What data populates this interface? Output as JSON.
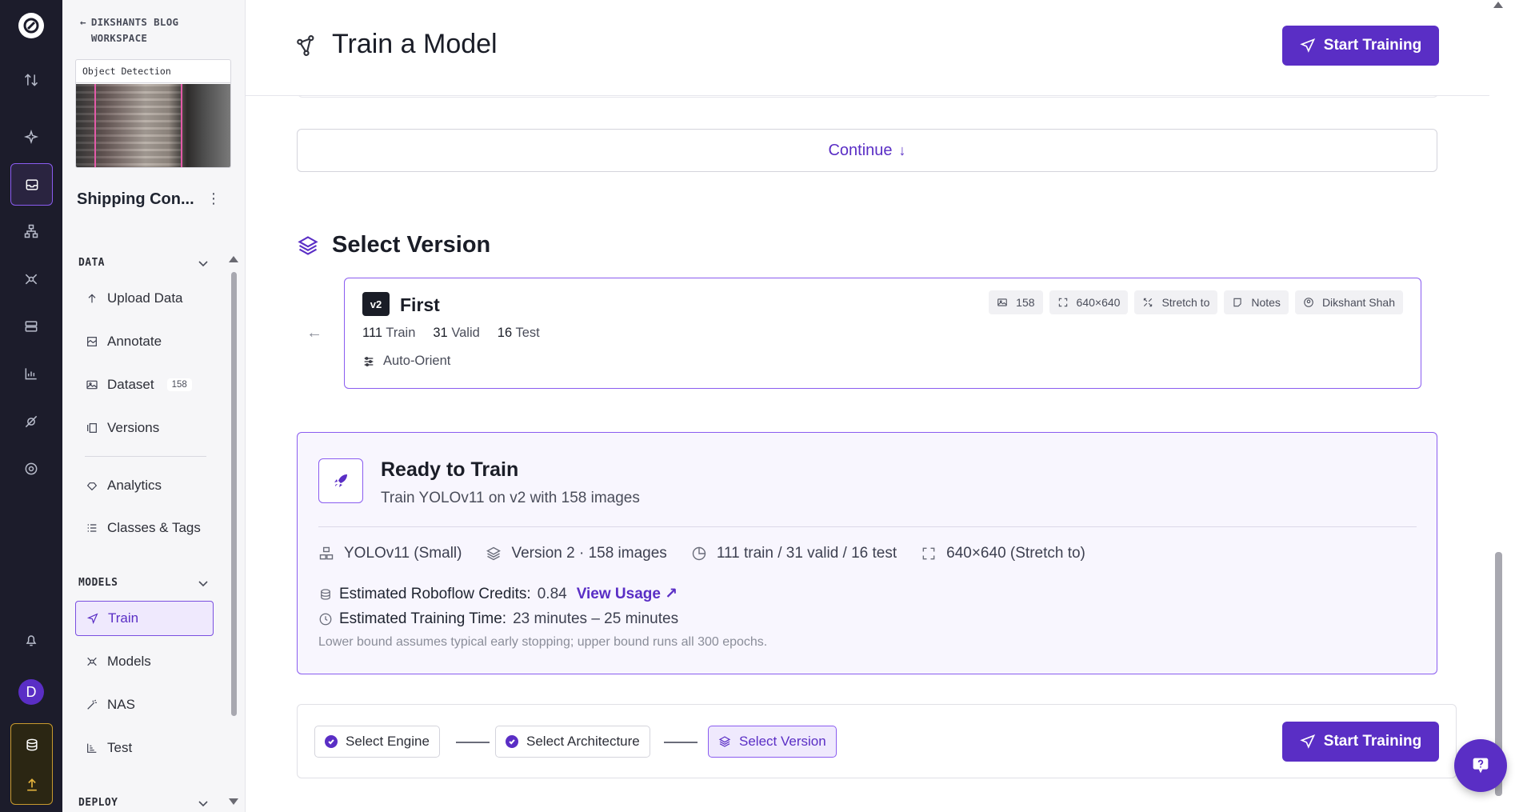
{
  "sidebar": {
    "workspace_line1": "DIKSHANTS BLOG",
    "workspace_line2": "WORKSPACE",
    "thumb_caption": "Object Detection",
    "project_name": "Shipping Con...",
    "data_section": "DATA",
    "data_items": [
      {
        "label": "Upload Data",
        "icon": "upload-icon"
      },
      {
        "label": "Annotate",
        "icon": "annotate-icon"
      },
      {
        "label": "Dataset",
        "icon": "image-icon",
        "badge": "158"
      },
      {
        "label": "Versions",
        "icon": "versions-icon"
      },
      {
        "label": "Analytics",
        "icon": "analytics-icon"
      },
      {
        "label": "Classes & Tags",
        "icon": "list-icon"
      }
    ],
    "models_section": "MODELS",
    "model_items": [
      {
        "label": "Train",
        "icon": "send-icon",
        "active": true
      },
      {
        "label": "Models",
        "icon": "models-icon"
      },
      {
        "label": "NAS",
        "icon": "wand-icon"
      },
      {
        "label": "Test",
        "icon": "chart-icon"
      }
    ],
    "deploy_section": "DEPLOY"
  },
  "rail": {
    "avatar_letter": "D"
  },
  "header": {
    "title": "Train a Model",
    "start_training": "Start Training"
  },
  "continue_label": "Continue",
  "select_version": {
    "heading": "Select Version",
    "version": {
      "badge": "v2",
      "name": "First",
      "train_count": "111",
      "train_label": "Train",
      "valid_count": "31",
      "valid_label": "Valid",
      "test_count": "16",
      "test_label": "Test",
      "preprocessing": "Auto-Orient",
      "chips": [
        {
          "icon": "image-icon",
          "label": "158"
        },
        {
          "icon": "resize-icon",
          "label": "640×640"
        },
        {
          "icon": "stretch-icon",
          "label": "Stretch to"
        },
        {
          "icon": "notes-icon",
          "label": "Notes"
        },
        {
          "icon": "user-icon",
          "label": "Dikshant Shah"
        }
      ]
    }
  },
  "ready": {
    "title": "Ready to Train",
    "subtitle": "Train YOLOv11 on v2 with 158 images",
    "stats": [
      {
        "icon": "model-icon",
        "label": "YOLOv11 (Small)"
      },
      {
        "icon": "layers-icon",
        "label": "Version 2 · 158 images"
      },
      {
        "icon": "pie-icon",
        "label": "111 train / 31 valid / 16 test"
      },
      {
        "icon": "resize-icon",
        "label": "640×640 (Stretch to)"
      }
    ],
    "credits_label": "Estimated Roboflow Credits:",
    "credits_value": "0.84",
    "view_usage": "View Usage",
    "time_label": "Estimated Training Time:",
    "time_value": "23 minutes – 25 minutes",
    "note": "Lower bound assumes typical early stopping; upper bound runs all 300 epochs."
  },
  "stepper": {
    "steps": [
      {
        "label": "Select Engine",
        "state": "done"
      },
      {
        "label": "Select Architecture",
        "state": "done"
      },
      {
        "label": "Select Version",
        "state": "current"
      }
    ],
    "start_training": "Start Training"
  },
  "colors": {
    "accent": "#5a2ec5",
    "rail_bg": "#1c1c2b",
    "sidebar_bg": "#f6f6f8"
  }
}
